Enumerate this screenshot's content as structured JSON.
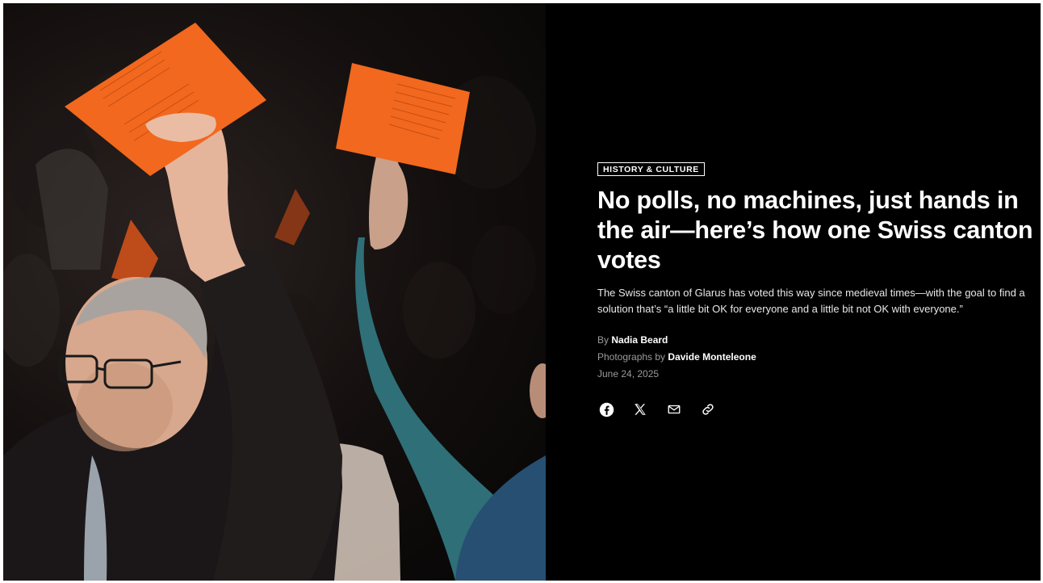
{
  "hero_photo": {
    "subject": "voters-raising-orange-ballots"
  },
  "article": {
    "category": "HISTORY & CULTURE",
    "headline": "No polls, no machines, just hands in the air—here’s how one Swiss canton votes",
    "dek": "The Swiss canton of Glarus has voted this way since medieval times—with the goal to find a solution that’s “a little bit OK for everyone and a little bit not OK with everyone.”",
    "byline": {
      "prefix": "By",
      "author": "Nadia Beard"
    },
    "photo_credit": {
      "prefix": "Photographs by",
      "photographer": "Davide Monteleone"
    },
    "date": "June 24, 2025"
  },
  "share": {
    "icons": [
      "facebook-icon",
      "x-icon",
      "email-icon",
      "link-icon"
    ]
  },
  "colors": {
    "background": "#000000",
    "text": "#ffffff",
    "muted": "#9a9a9a",
    "ballot_orange": "#f2681e"
  }
}
